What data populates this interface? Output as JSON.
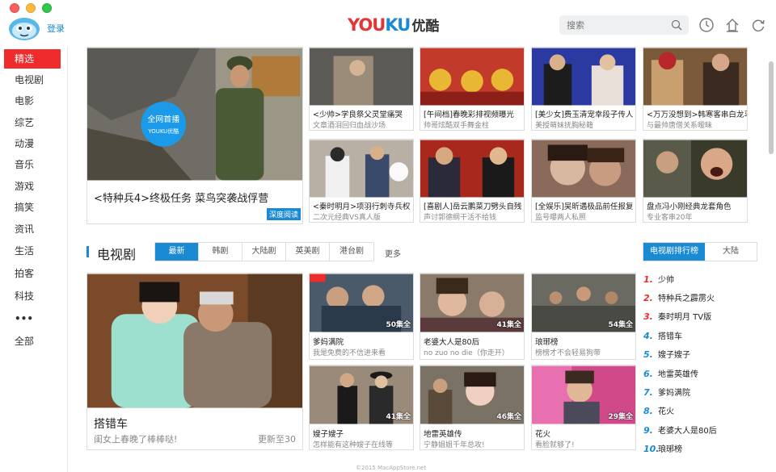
{
  "window": {
    "title": "YOUKU优酷"
  },
  "header": {
    "login_label": "登录",
    "logo_latin": "YOUKU",
    "logo_cn": "优酷",
    "search_placeholder": "搜索",
    "icons": [
      "search-icon",
      "history-icon",
      "upload-icon",
      "refresh-icon"
    ]
  },
  "sidebar": {
    "items": [
      {
        "label": "精选",
        "active": true
      },
      {
        "label": "电视剧"
      },
      {
        "label": "电影"
      },
      {
        "label": "综艺"
      },
      {
        "label": "动漫"
      },
      {
        "label": "音乐"
      },
      {
        "label": "游戏"
      },
      {
        "label": "搞笑"
      },
      {
        "label": "资讯"
      },
      {
        "label": "生活"
      },
      {
        "label": "拍客"
      },
      {
        "label": "科技"
      },
      {
        "label": "•••"
      },
      {
        "label": "全部"
      }
    ]
  },
  "featured": {
    "title": "<特种兵4>终极任务 菜鸟突袭战俘营",
    "badge": "深度阅读",
    "ribbon": "全网首播",
    "ribbon_brand": "YOUKU优酷"
  },
  "top_tiles": [
    {
      "title": "<少帅>学良祭父灵堂痛哭",
      "sub": "文章酒泪回归血战沙场"
    },
    {
      "title": "[午间档]春晚彩排视频曝光",
      "sub": "帅哥炫酷双手舞金柱"
    },
    {
      "title": "[美少女]费玉清宠幸段子传人",
      "sub": "美授萌妹抚胸秘籍"
    },
    {
      "title": "<万万没想到>韩寒客串白龙马",
      "sub": "与最帅唐僧关系暧昧"
    },
    {
      "title": "<秦时明月>项羽行刺寺兵权",
      "sub": "二次元经典VS真人版"
    },
    {
      "title": "[喜剧人]岳云鹏菜刀劈头自残",
      "sub": "声讨郭德纲干活不给钱"
    },
    {
      "title": "[全娱乐]吴昕遇极品前任报复",
      "sub": "监号曝两人私照"
    },
    {
      "title": "盘点冯小刚经典龙套角色",
      "sub": "专业客串20年"
    }
  ],
  "tv_section": {
    "title": "电视剧",
    "tabs": [
      "最新",
      "韩剧",
      "大陆剧",
      "英美剧",
      "港台剧"
    ],
    "more_label": "更多",
    "rank_tabs": [
      "电视剧排行榜",
      "大陆"
    ],
    "big": {
      "title": "搭错车",
      "sub": "闺女上春晚了棒棒哒!",
      "status": "更新至30"
    },
    "tiles": [
      {
        "title": "爹妈满院",
        "sub": "我是免费的不信进来看",
        "badge": "50集全"
      },
      {
        "title": "老婆大人是80后",
        "sub": "no zuo no die（你走开）",
        "badge": "41集全"
      },
      {
        "title": "琅琊榜",
        "sub": "榜榜才不会轻易狗带",
        "badge": "54集全"
      },
      {
        "title": "嫂子嫂子",
        "sub": "怎样能有这种嫂子在线等",
        "badge": "41集全"
      },
      {
        "title": "地雷英雄传",
        "sub": "宁静姐姐千年总攻!",
        "badge": "46集全"
      },
      {
        "title": "花火",
        "sub": "看脸就够了!",
        "badge": "29集全"
      }
    ],
    "ranking": [
      {
        "num": "1.",
        "title": "少帅"
      },
      {
        "num": "2.",
        "title": "特种兵之霹雳火"
      },
      {
        "num": "3.",
        "title": "秦时明月 TV版"
      },
      {
        "num": "4.",
        "title": "搭错车"
      },
      {
        "num": "5.",
        "title": "嫂子嫂子"
      },
      {
        "num": "6.",
        "title": "地雷英雄传"
      },
      {
        "num": "7.",
        "title": "爹妈满院"
      },
      {
        "num": "8.",
        "title": "花火"
      },
      {
        "num": "9.",
        "title": "老婆大人是80后"
      },
      {
        "num": "10.",
        "title": "琅琊榜"
      }
    ]
  },
  "footer": {
    "text": "©2015 MacAppStore.net"
  }
}
